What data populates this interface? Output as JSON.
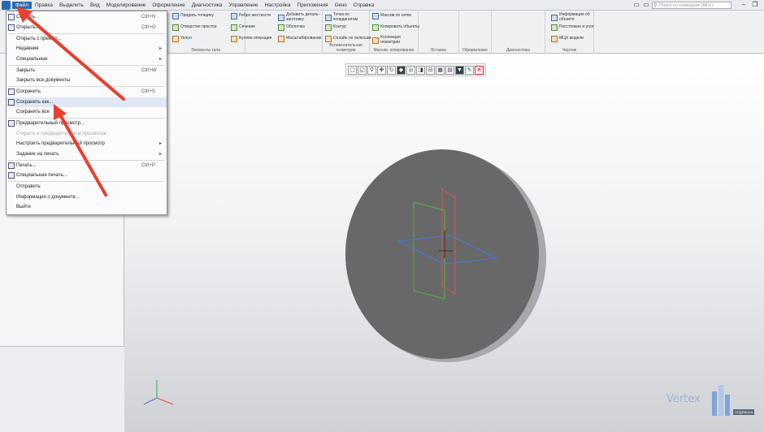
{
  "menubar": {
    "items": [
      "Файл",
      "Правка",
      "Выделить",
      "Вид",
      "Моделирование",
      "Оформление",
      "Диагностика",
      "Управление",
      "Настройка",
      "Приложения",
      "Окно",
      "Справка"
    ],
    "active_index": 0,
    "search_placeholder": "Поиск по командам (Alt+/)"
  },
  "ribbon": {
    "group_titles": [
      "Элементы тела",
      "Вспомогательная геометрия",
      "Массив, копирование",
      "Вставка",
      "Оформление",
      "Диагностика",
      "Чертеж"
    ],
    "buttons": [
      {
        "label": "Придать толщину",
        "icon": "thicken-icon"
      },
      {
        "label": "Отверстие простое",
        "icon": "hole-icon"
      },
      {
        "label": "Уклон",
        "icon": "draft-icon"
      },
      {
        "label": "Ребро жесткости",
        "icon": "rib-icon"
      },
      {
        "label": "Сечение",
        "icon": "section-icon"
      },
      {
        "label": "Булева операция",
        "icon": "boolean-icon"
      },
      {
        "label": "Добавить деталь-заготовку",
        "icon": "add-part-icon"
      },
      {
        "label": "Оболочка",
        "icon": "shell-icon"
      },
      {
        "label": "Масштабирование",
        "icon": "scale-icon"
      },
      {
        "label": "Точка по координатам",
        "icon": "point-icon"
      },
      {
        "label": "Контур",
        "icon": "contour-icon"
      },
      {
        "label": "Сплайн по полюсам",
        "icon": "spline-icon"
      },
      {
        "label": "Массив по сетке",
        "icon": "grid-array-icon"
      },
      {
        "label": "Копировать объекты",
        "icon": "copy-icon"
      },
      {
        "label": "Коллекция геометрии",
        "icon": "collection-icon"
      },
      {
        "label": "Информация об объекте",
        "icon": "info-icon"
      },
      {
        "label": "Расстояние и угол",
        "icon": "distance-icon"
      },
      {
        "label": "МЦХ модели",
        "icon": "mass-icon"
      }
    ]
  },
  "file_menu": {
    "items": [
      {
        "label": "Создать...",
        "shortcut": "Ctrl+N",
        "icon": true
      },
      {
        "label": "Открыть...",
        "shortcut": "Ctrl+O",
        "icon": true
      },
      {
        "label": "Открыть с превью...",
        "shortcut": ""
      },
      {
        "label": "Недавние",
        "shortcut": "",
        "submenu": true
      },
      {
        "label": "Специальные",
        "shortcut": "",
        "submenu": true
      },
      {
        "label": "Закрыть",
        "shortcut": "Ctrl+W"
      },
      {
        "label": "Закрыть все документы",
        "shortcut": ""
      },
      {
        "label": "Сохранить",
        "shortcut": "Ctrl+S",
        "icon": true
      },
      {
        "label": "Сохранить как...",
        "shortcut": "",
        "icon": true,
        "highlight": true
      },
      {
        "label": "Сохранить все",
        "shortcut": ""
      },
      {
        "label": "Предварительный просмотр...",
        "shortcut": "",
        "icon": true
      },
      {
        "label": "Открыть в предварительном просмотре",
        "shortcut": "",
        "dim": true
      },
      {
        "label": "Настроить предварительный просмотр",
        "shortcut": "",
        "submenu": true
      },
      {
        "label": "Задание на печать",
        "shortcut": "",
        "submenu": true
      },
      {
        "label": "Печать...",
        "shortcut": "Ctrl+P",
        "icon": true
      },
      {
        "label": "Специальная печать...",
        "shortcut": "",
        "icon": true
      },
      {
        "label": "Отправить",
        "shortcut": ""
      },
      {
        "label": "Информация о документе...",
        "shortcut": ""
      },
      {
        "label": "Выйти",
        "shortcut": ""
      }
    ]
  },
  "logo": {
    "text": "Vertex",
    "tag": "ПОДПИСКА"
  },
  "colors": {
    "accent": "#2a6ab0",
    "arrow": "#e8402f",
    "disk": "#666666",
    "plane_red": "#d9574a",
    "plane_green": "#4fb34f",
    "plane_blue": "#4a7ad9"
  }
}
